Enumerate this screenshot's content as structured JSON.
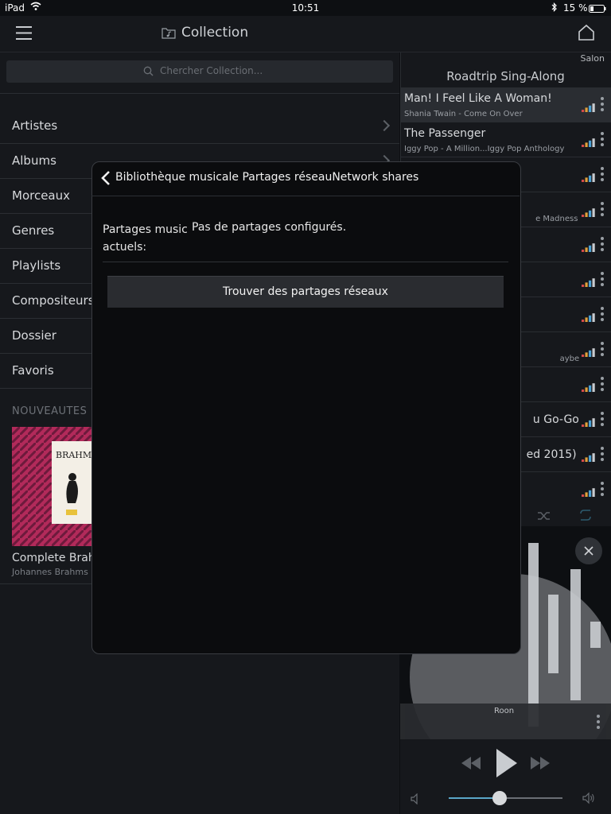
{
  "statusbar": {
    "device": "iPad",
    "time": "10:51",
    "battery": "15 %"
  },
  "header": {
    "title": "Collection"
  },
  "search": {
    "placeholder": "Chercher Collection..."
  },
  "nav": [
    {
      "label": "Artistes"
    },
    {
      "label": "Albums"
    },
    {
      "label": "Morceaux"
    },
    {
      "label": "Genres"
    },
    {
      "label": "Playlists"
    },
    {
      "label": "Compositeurs"
    },
    {
      "label": "Dossier"
    },
    {
      "label": "Favoris"
    }
  ],
  "new_section": {
    "label": "NOUVEAUTES"
  },
  "album": {
    "cover_text": "BRAHMS",
    "title": "Complete Brahm",
    "artist": "Johannes Brahms"
  },
  "queue": {
    "zone": "Salon",
    "title": "Roadtrip Sing-Along",
    "items": [
      {
        "title": "Man! I Feel Like A Woman!",
        "subtitle": "Shania Twain - Come On Over"
      },
      {
        "title": "The Passenger",
        "subtitle": "Iggy Pop - A Million...Iggy Pop Anthology"
      },
      {
        "title": "",
        "subtitle": ""
      },
      {
        "title": "",
        "subtitle": "e Madness"
      },
      {
        "title": "",
        "subtitle": ""
      },
      {
        "title": "",
        "subtitle": ""
      },
      {
        "title": "",
        "subtitle": ""
      },
      {
        "title": "",
        "subtitle": "aybe"
      },
      {
        "title": "",
        "subtitle": ""
      },
      {
        "title": "u Go-Go",
        "subtitle": ""
      },
      {
        "title": "ed 2015)",
        "subtitle": ""
      },
      {
        "title": "",
        "subtitle": ""
      }
    ]
  },
  "player": {
    "label": "Roon",
    "volume_level": 0.45
  },
  "modal": {
    "title": "Bibliothèque musicale  Partages réseauNetwork shares",
    "label_line1": "Partages music",
    "label_line2": "actuels:",
    "value": "Pas de partages configurés.",
    "button": "Trouver des partages réseaux"
  },
  "colors": {
    "accent": "#5aa6c8",
    "album_bg": "#b22a5a",
    "modal_bg": "#0b0c0e"
  }
}
